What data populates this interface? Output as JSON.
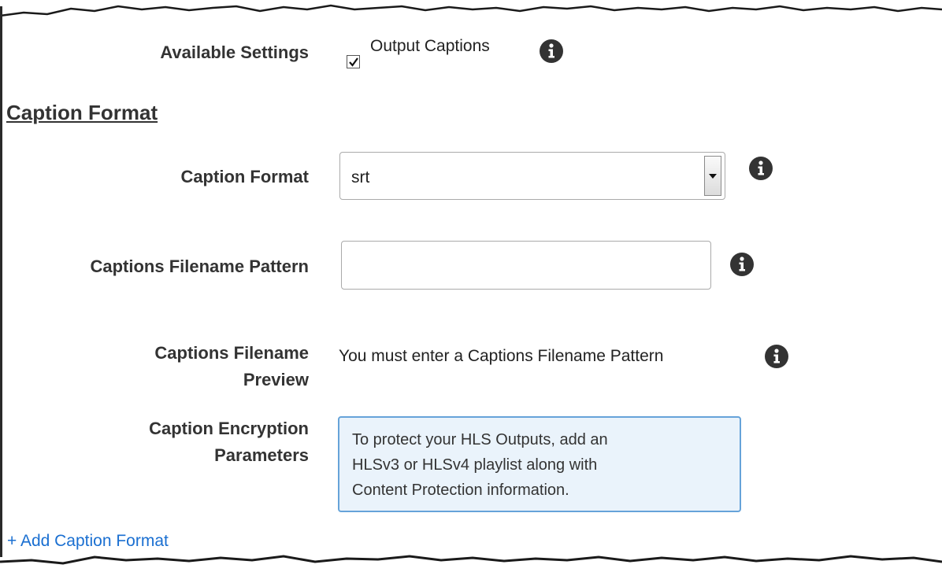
{
  "available_settings": {
    "label": "Available Settings",
    "checkbox_label": "Output Captions",
    "checked": true
  },
  "section": {
    "title": "Caption Format"
  },
  "caption_format": {
    "label": "Caption Format",
    "selected": "srt"
  },
  "filename_pattern": {
    "label": "Captions Filename Pattern",
    "value": ""
  },
  "filename_preview": {
    "label_line1": "Captions Filename",
    "label_line2": "Preview",
    "text": "You must enter a Captions Filename Pattern"
  },
  "encryption": {
    "label_line1": "Caption Encryption",
    "label_line2": "Parameters",
    "notice_line1": "To protect your HLS Outputs, add an",
    "notice_line2": "HLSv3 or HLSv4 playlist along with",
    "notice_line3": "Content Protection information."
  },
  "add_link": {
    "label": "+ Add Caption Format"
  },
  "colors": {
    "link": "#1a6fd1",
    "notice_border": "#66a3d9",
    "notice_bg": "#eaf3fb"
  }
}
